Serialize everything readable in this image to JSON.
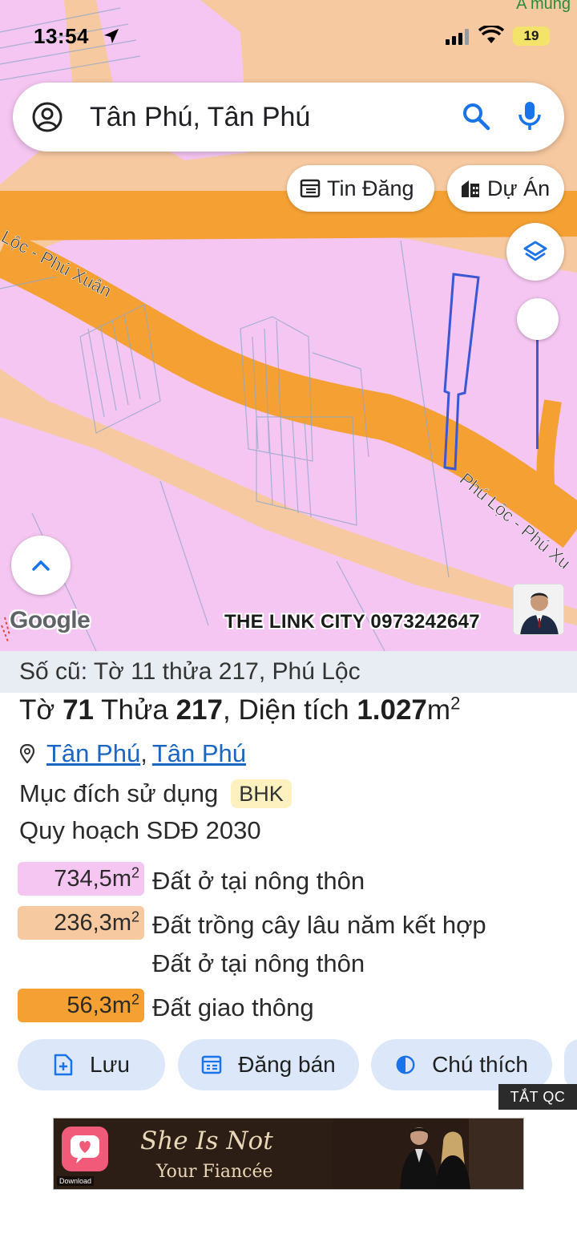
{
  "status_bar": {
    "time": "13:54",
    "battery": "19"
  },
  "map": {
    "corner_text": "A mung",
    "road_label_1": "Lộc - Phú Xuân",
    "road_label_2": "Phú Lộc - Phú Xu",
    "google_logo": "Google",
    "watermark": "THE LINK CITY 0973242647",
    "colors": {
      "residential": "#f5c6f1",
      "perennial": "#f6c9a0",
      "road": "#f5a033",
      "parcel_outline": "#3a57d6"
    }
  },
  "search": {
    "value": "Tân Phú, Tân Phú"
  },
  "chips": {
    "listings": "Tin Đăng",
    "projects": "Dự Án"
  },
  "panel": {
    "old_ref": "Số cũ: Tờ 11 thửa 217, Phú Lộc",
    "title": {
      "sheet_label": "Tờ",
      "sheet": "71",
      "parcel_label": "Thửa",
      "parcel": "217",
      "area_label": ", Diện tích",
      "area": "1.027",
      "unit": "m",
      "unit_sup": "2"
    },
    "location": {
      "ward": "Tân Phú",
      "district": "Tân Phú"
    },
    "purpose_label": "Mục đích sử dụng",
    "purpose_code": "BHK",
    "plan_title": "Quy hoạch SDĐ 2030",
    "zones": [
      {
        "area": "734,5",
        "unit": "m",
        "sup": "2",
        "label": "Đất ở tại nông thôn",
        "label2": "",
        "color": "#f5c6f1"
      },
      {
        "area": "236,3",
        "unit": "m",
        "sup": "2",
        "label": "Đất trồng cây lâu năm kết hợp",
        "label2": "Đất ở tại nông thôn",
        "color": "#f6c9a0"
      },
      {
        "area": "56,3",
        "unit": "m",
        "sup": "2",
        "label": "Đất giao thông",
        "label2": "",
        "color": "#f5a033"
      }
    ],
    "actions": {
      "save": "Lưu",
      "post": "Đăng bán",
      "legend": "Chú thích"
    }
  },
  "ad": {
    "close": "TẮT QC",
    "title": "She Is Not",
    "subtitle": "Your Fiancée",
    "download": "Download"
  }
}
